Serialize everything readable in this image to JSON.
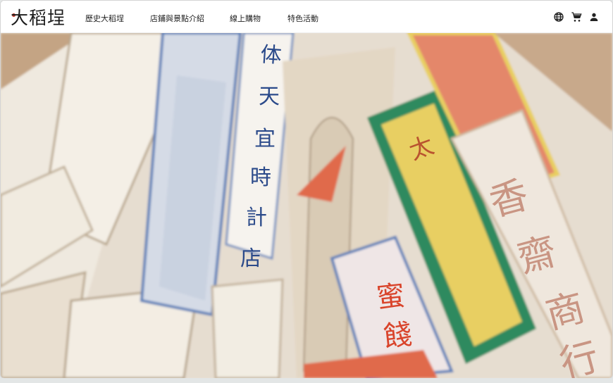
{
  "logo": {
    "text": "大稻埕"
  },
  "nav": {
    "items": [
      {
        "label": "歷史大稻埕"
      },
      {
        "label": "店鋪與景點介紹"
      },
      {
        "label": "線上購物"
      },
      {
        "label": "特色活動"
      }
    ]
  },
  "icons": [
    "globe-icon",
    "cart-icon",
    "user-icon"
  ],
  "hero": {
    "signs": [
      "体天宜時計店",
      "蜜餞",
      "香齋商行",
      "太"
    ]
  },
  "colors": {
    "accent": "#c0392b",
    "green": "#2f8a5e",
    "yellow": "#e8cf62",
    "blue": "#5b7fb8"
  }
}
